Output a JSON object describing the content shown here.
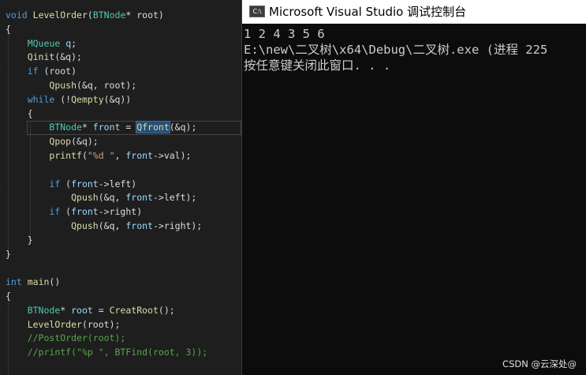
{
  "editor": {
    "lines": [
      {
        "segs": [
          {
            "t": "void",
            "c": "kw"
          },
          {
            "t": " ",
            "c": "pl"
          },
          {
            "t": "LevelOrder",
            "c": "fn"
          },
          {
            "t": "(",
            "c": "pl"
          },
          {
            "t": "BTNode",
            "c": "ty"
          },
          {
            "t": "* root)",
            "c": "pl"
          }
        ]
      },
      {
        "segs": [
          {
            "t": "{",
            "c": "pl"
          }
        ]
      },
      {
        "segs": [
          {
            "t": "    ",
            "c": "pl"
          },
          {
            "t": "MQueue",
            "c": "ty"
          },
          {
            "t": " ",
            "c": "pl"
          },
          {
            "t": "q",
            "c": "var"
          },
          {
            "t": ";",
            "c": "pl"
          }
        ]
      },
      {
        "segs": [
          {
            "t": "    ",
            "c": "pl"
          },
          {
            "t": "Qinit",
            "c": "fn"
          },
          {
            "t": "(&q);",
            "c": "pl"
          }
        ]
      },
      {
        "segs": [
          {
            "t": "    ",
            "c": "pl"
          },
          {
            "t": "if",
            "c": "kw"
          },
          {
            "t": " (root)",
            "c": "pl"
          }
        ]
      },
      {
        "segs": [
          {
            "t": "        ",
            "c": "pl"
          },
          {
            "t": "Qpush",
            "c": "fn"
          },
          {
            "t": "(&q, root);",
            "c": "pl"
          }
        ]
      },
      {
        "segs": [
          {
            "t": "    ",
            "c": "pl"
          },
          {
            "t": "while",
            "c": "kw"
          },
          {
            "t": " (!",
            "c": "pl"
          },
          {
            "t": "Qempty",
            "c": "fn"
          },
          {
            "t": "(&q))",
            "c": "pl"
          }
        ]
      },
      {
        "segs": [
          {
            "t": "    {",
            "c": "pl"
          }
        ]
      },
      {
        "segs": [
          {
            "t": "        ",
            "c": "pl"
          },
          {
            "t": "BTNode",
            "c": "ty"
          },
          {
            "t": "* ",
            "c": "pl"
          },
          {
            "t": "front",
            "c": "var"
          },
          {
            "t": " = ",
            "c": "pl"
          },
          {
            "t": "Qfront",
            "c": "fn hl"
          },
          {
            "t": "(&q);",
            "c": "pl"
          }
        ]
      },
      {
        "segs": [
          {
            "t": "        ",
            "c": "pl"
          },
          {
            "t": "Qpop",
            "c": "fn"
          },
          {
            "t": "(&q);",
            "c": "pl"
          }
        ]
      },
      {
        "segs": [
          {
            "t": "        ",
            "c": "pl"
          },
          {
            "t": "printf",
            "c": "fn"
          },
          {
            "t": "(",
            "c": "pl"
          },
          {
            "t": "\"%d \"",
            "c": "str"
          },
          {
            "t": ", ",
            "c": "pl"
          },
          {
            "t": "front",
            "c": "var"
          },
          {
            "t": "->val);",
            "c": "pl"
          }
        ]
      },
      {
        "segs": [
          {
            "t": "",
            "c": "pl"
          }
        ]
      },
      {
        "segs": [
          {
            "t": "        ",
            "c": "pl"
          },
          {
            "t": "if",
            "c": "kw"
          },
          {
            "t": " (",
            "c": "pl"
          },
          {
            "t": "front",
            "c": "var"
          },
          {
            "t": "->left)",
            "c": "pl"
          }
        ]
      },
      {
        "segs": [
          {
            "t": "            ",
            "c": "pl"
          },
          {
            "t": "Qpush",
            "c": "fn"
          },
          {
            "t": "(&q, ",
            "c": "pl"
          },
          {
            "t": "front",
            "c": "var"
          },
          {
            "t": "->left);",
            "c": "pl"
          }
        ]
      },
      {
        "segs": [
          {
            "t": "        ",
            "c": "pl"
          },
          {
            "t": "if",
            "c": "kw"
          },
          {
            "t": " (",
            "c": "pl"
          },
          {
            "t": "front",
            "c": "var"
          },
          {
            "t": "->right)",
            "c": "pl"
          }
        ]
      },
      {
        "segs": [
          {
            "t": "            ",
            "c": "pl"
          },
          {
            "t": "Qpush",
            "c": "fn"
          },
          {
            "t": "(&q, ",
            "c": "pl"
          },
          {
            "t": "front",
            "c": "var"
          },
          {
            "t": "->right);",
            "c": "pl"
          }
        ]
      },
      {
        "segs": [
          {
            "t": "    }",
            "c": "pl"
          }
        ]
      },
      {
        "segs": [
          {
            "t": "}",
            "c": "pl"
          }
        ]
      },
      {
        "segs": [
          {
            "t": "",
            "c": "pl"
          }
        ]
      },
      {
        "segs": [
          {
            "t": "int",
            "c": "kw"
          },
          {
            "t": " ",
            "c": "pl"
          },
          {
            "t": "main",
            "c": "fn"
          },
          {
            "t": "()",
            "c": "pl"
          }
        ]
      },
      {
        "segs": [
          {
            "t": "{",
            "c": "pl"
          }
        ]
      },
      {
        "segs": [
          {
            "t": "    ",
            "c": "pl"
          },
          {
            "t": "BTNode",
            "c": "ty"
          },
          {
            "t": "* ",
            "c": "pl"
          },
          {
            "t": "root",
            "c": "var"
          },
          {
            "t": " = ",
            "c": "pl"
          },
          {
            "t": "CreatRoot",
            "c": "fn"
          },
          {
            "t": "();",
            "c": "pl"
          }
        ]
      },
      {
        "segs": [
          {
            "t": "    ",
            "c": "pl"
          },
          {
            "t": "LevelOrder",
            "c": "fn"
          },
          {
            "t": "(root);",
            "c": "pl"
          }
        ]
      },
      {
        "segs": [
          {
            "t": "    ",
            "c": "pl"
          },
          {
            "t": "//PostOrder(root);",
            "c": "cm"
          }
        ]
      },
      {
        "segs": [
          {
            "t": "    ",
            "c": "pl"
          },
          {
            "t": "//printf(\"%p \", BTFind(root, 3));",
            "c": "cm"
          }
        ]
      }
    ]
  },
  "console": {
    "title": "Microsoft Visual Studio 调试控制台",
    "icon_text": "C:\\",
    "output": [
      "1 2 4 3 5 6",
      "E:\\new\\二叉树\\x64\\Debug\\二叉树.exe (进程 225",
      "按任意键关闭此窗口. . ."
    ]
  },
  "watermark": "CSDN @云深处@"
}
